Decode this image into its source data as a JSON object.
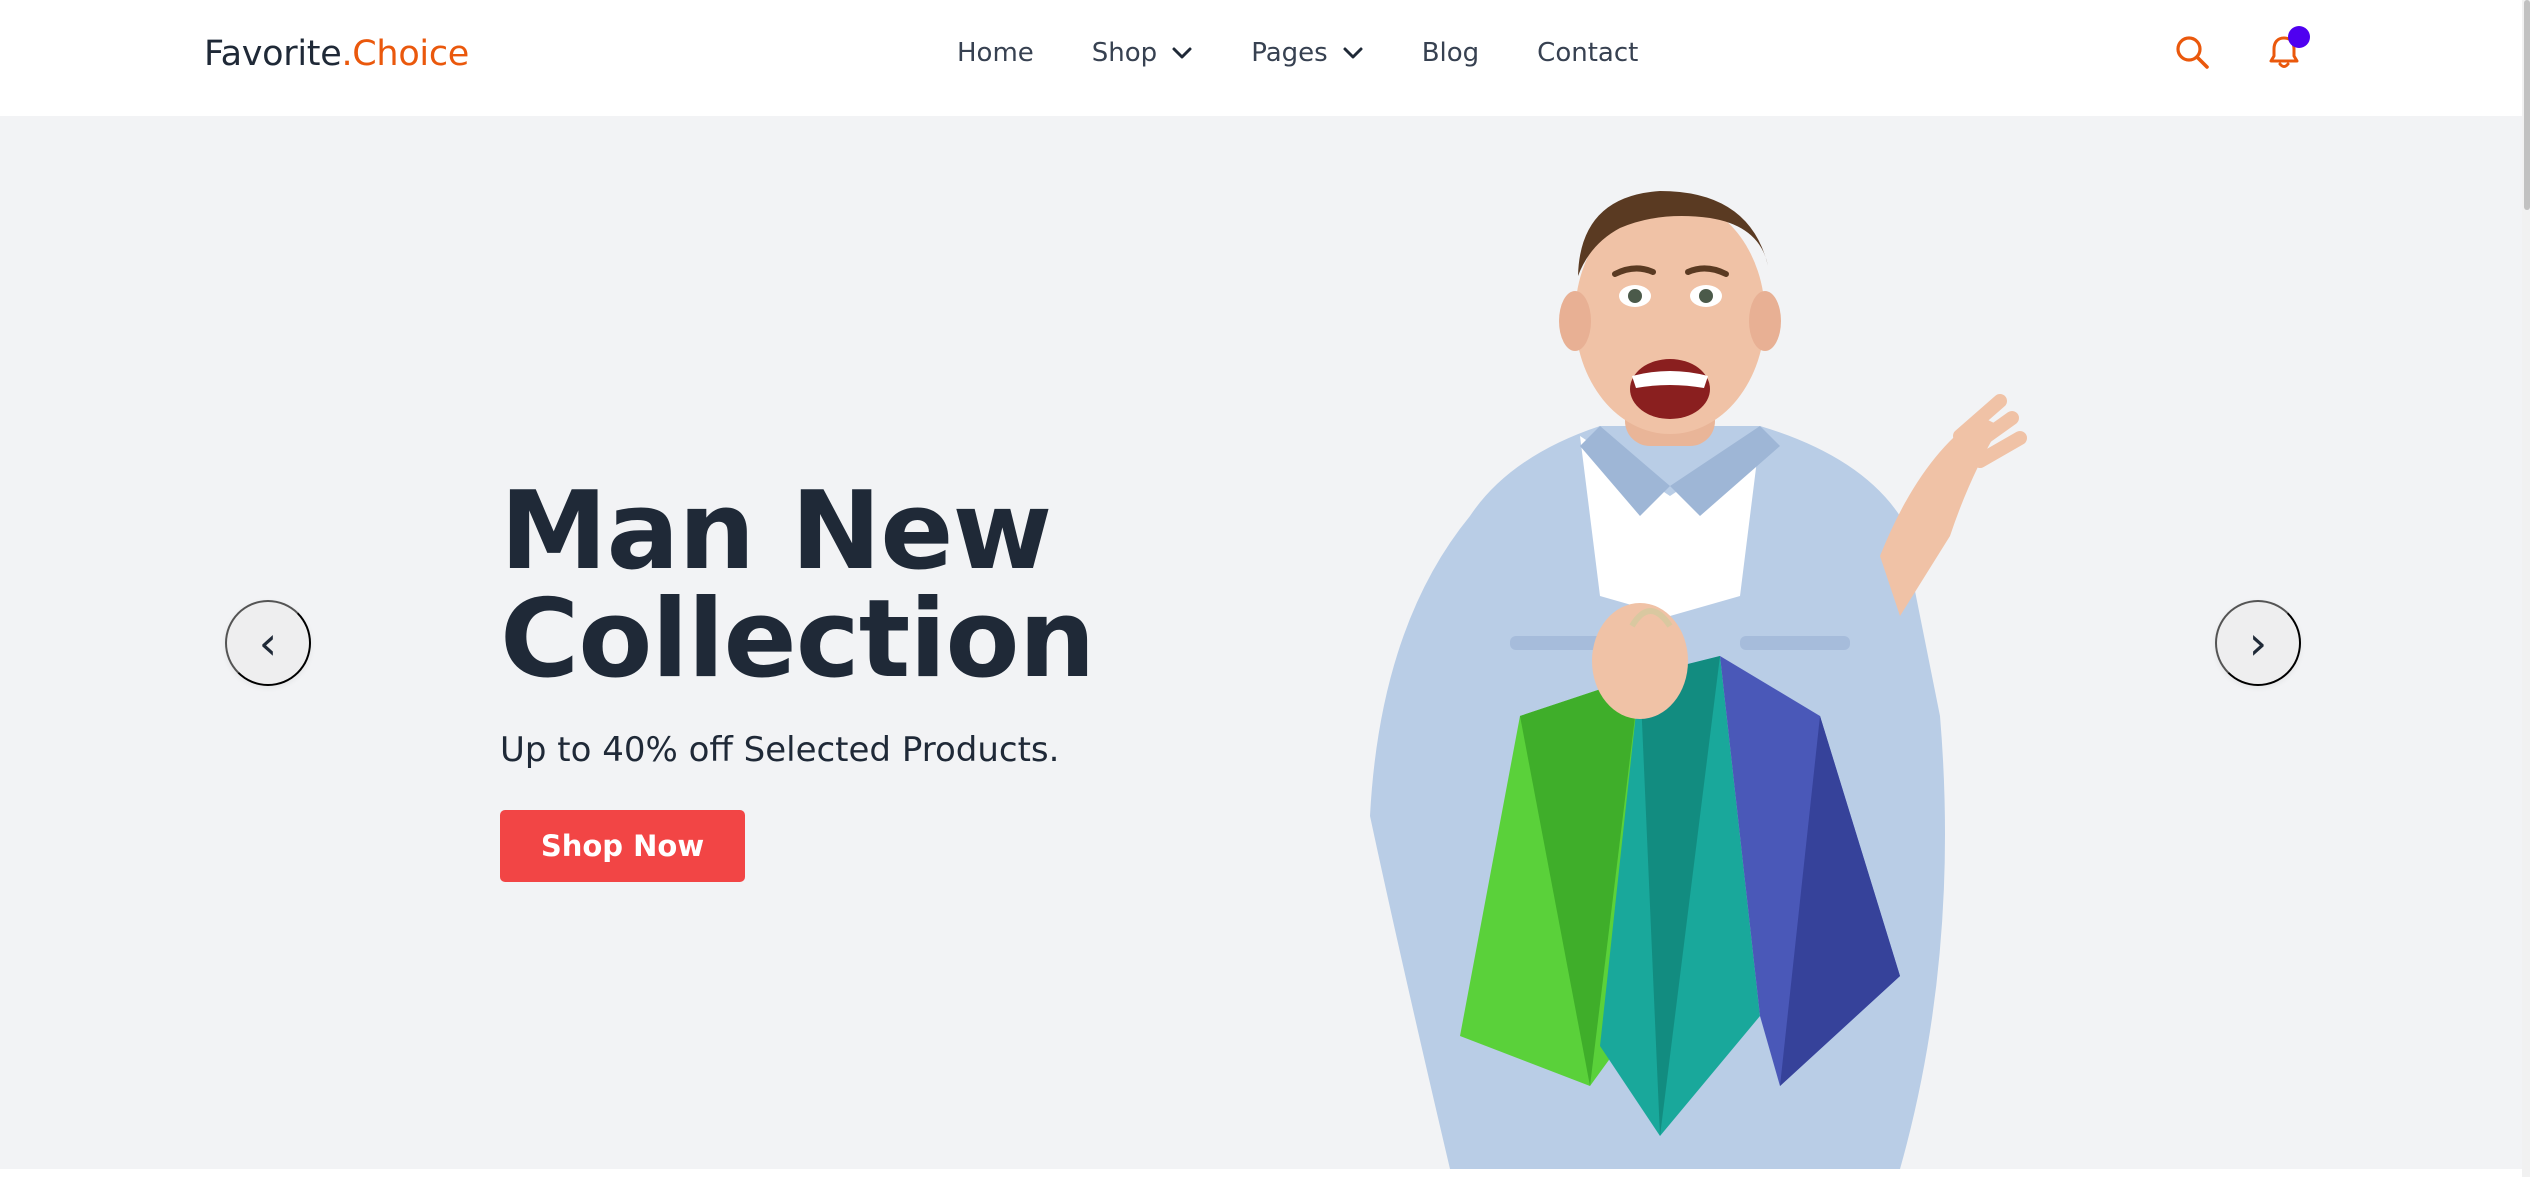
{
  "header": {
    "logo_main": "Favorite",
    "logo_accent": ".Choice",
    "nav": [
      {
        "label": "Home"
      },
      {
        "label": "Shop"
      },
      {
        "label": "Pages"
      },
      {
        "label": "Blog"
      },
      {
        "label": "Contact"
      }
    ],
    "icons": [
      "search-icon",
      "bell-icon"
    ],
    "accent_color": "#ea580c",
    "badge_color": "#4f00f0"
  },
  "hero": {
    "title_line1": "Man New",
    "title_line2": "Collection",
    "subtitle": "Up to 40% off Selected Products.",
    "cta_label": "Shop Now",
    "cta_color": "#f24545",
    "prev_arrow": "‹",
    "next_arrow": "›",
    "image": "man-with-shopping-bags"
  }
}
